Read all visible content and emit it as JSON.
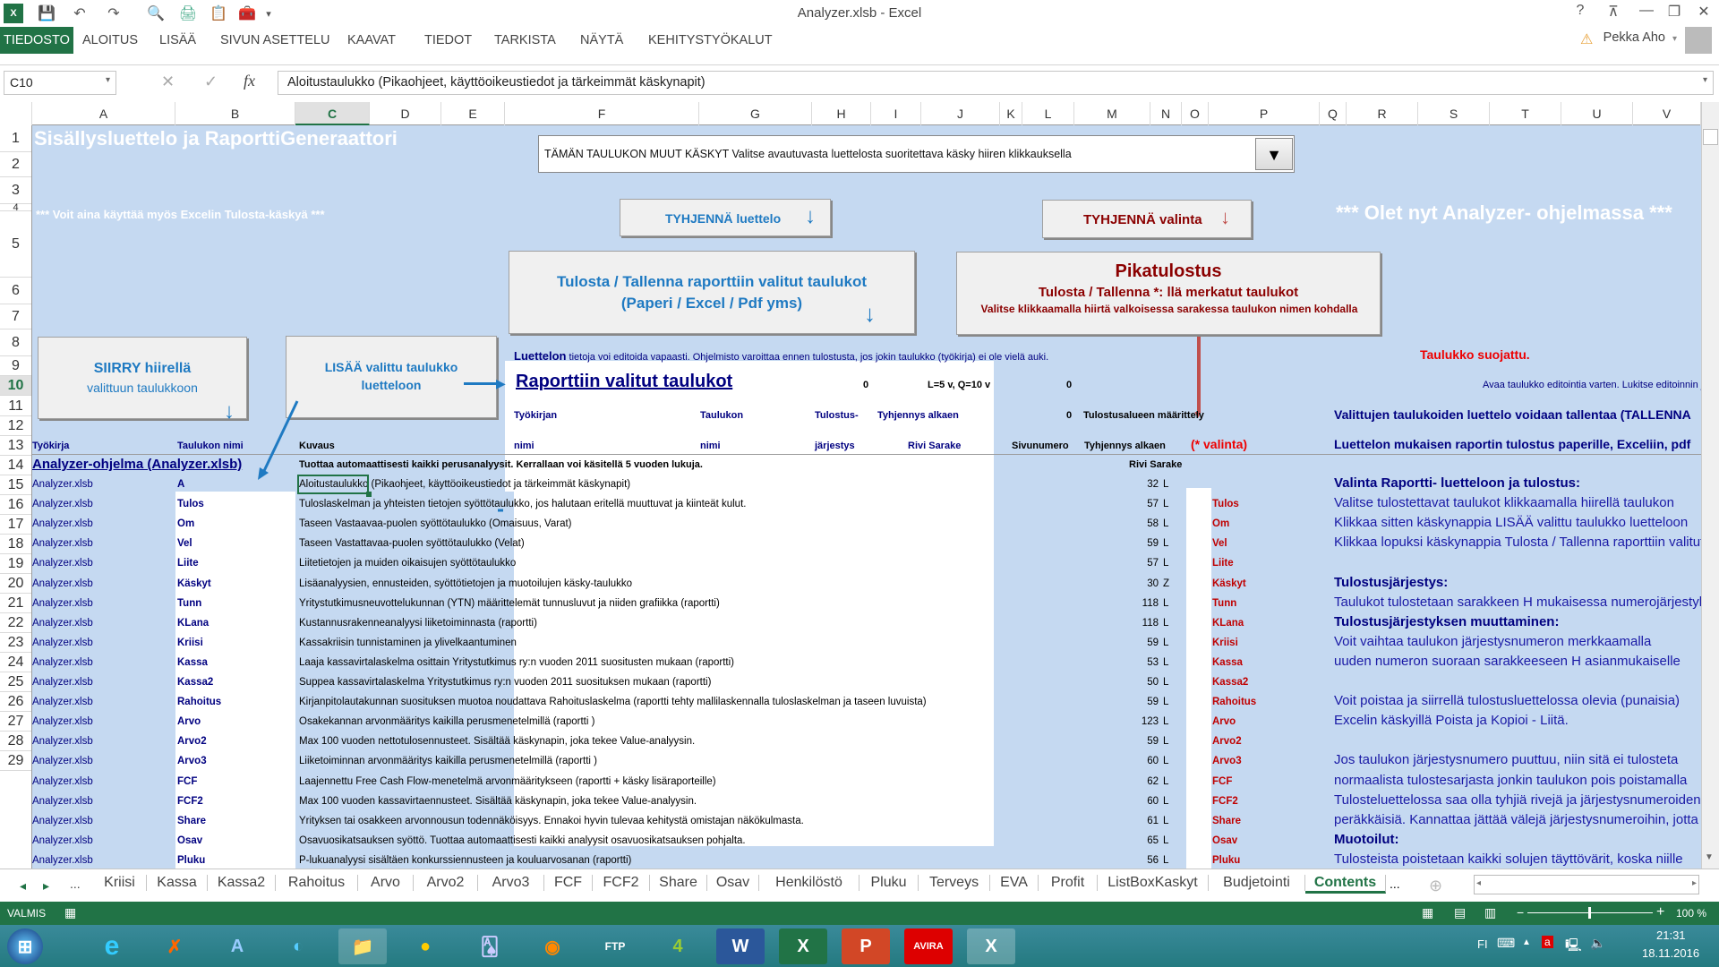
{
  "window": {
    "title": "Analyzer.xlsb - Excel",
    "help": "?",
    "ribbon_display": "⊼",
    "minimize": "—",
    "restore": "❐",
    "close": "✕"
  },
  "qat": {
    "save": "💾",
    "undo": "↶",
    "redo": "↷",
    "print_preview": "🔍",
    "customize": "▾"
  },
  "ribbon": {
    "tabs": [
      "TIEDOSTO",
      "ALOITUS",
      "LISÄÄ",
      "SIVUN ASETTELU",
      "KAAVAT",
      "TIEDOT",
      "TARKISTA",
      "NÄYTÄ",
      "KEHITYSTYÖKALUT"
    ],
    "user": "Pekka Aho",
    "warning_icon": "⚠"
  },
  "formula_bar": {
    "name_box": "C10",
    "cancel": "✕",
    "enter": "✓",
    "fx": "fx",
    "content": "Aloitustaulukko (Pikaohjeet, käyttöoikeustiedot ja tärkeimmät käskynapit)"
  },
  "columns": [
    "A",
    "B",
    "C",
    "D",
    "E",
    "F",
    "G",
    "H",
    "I",
    "J",
    "K",
    "L",
    "M",
    "N",
    "O",
    "P",
    "Q",
    "R",
    "S",
    "T",
    "U",
    "V"
  ],
  "rows": [
    "1",
    "2",
    "3",
    "4",
    "5",
    "6",
    "7",
    "8",
    "9",
    "10",
    "11",
    "12",
    "13",
    "14",
    "15",
    "16",
    "17",
    "18",
    "19",
    "20",
    "21",
    "22",
    "23",
    "24",
    "25",
    "26",
    "27",
    "28",
    "29"
  ],
  "sheet": {
    "title": "Sisällysluettelo ja RaporttiGeneraattori",
    "subtitle": "*** Voit aina käyttää myös Excelin Tulosta-käskyä ***",
    "program_notice": "*** Olet nyt Analyzer- ohjelmassa ***",
    "commands_dropdown": "TÄMÄN TAULUKON MUUT KÄSKYT   Valitse avautuvasta luettelosta suoritettava käsky hiiren klikkauksella",
    "btn_clear_list": "TYHJENNÄ luettelo",
    "btn_clear_selection": "TYHJENNÄ valinta",
    "btn_print_line1": "Tulosta / Tallenna raporttiin valitut taulukot",
    "btn_print_line2": "(Paperi / Excel / Pdf yms)",
    "btn_quick_title": "Pikatulostus",
    "btn_quick_line1": "Tulosta / Tallenna *: llä merkatut taulukot",
    "btn_quick_line2": "Valitse klikkaamalla hiirtä  valkoisessa sarakessa taulukon nimen kohdalla",
    "btn_goto_line1": "SIIRRY hiirellä",
    "btn_goto_line2": "valittuun taulukkoon",
    "btn_add_line1": "LISÄÄ valittu taulukko",
    "btn_add_line2": "luetteloon",
    "luettelon_bold": "Luettelon",
    "luettelon_text": " tietoja voi editoida vapaasti. Ohjelmisto varoittaa ennen tulostusta, jos jokin taulukko (työkirja) ei ole vielä auki.",
    "protected": "Taulukko suojattu.",
    "report_title": "Raporttiin valitut taulukot",
    "r6_h": "0",
    "r6_j": "L=5 v, Q=10 v",
    "r6_l": "0",
    "r6_right": "Avaa taulukko editointia varten. Lukitse editoinnin jälkeen",
    "r7_f": "Työkirjan",
    "r7_g": "Taulukon",
    "r7_h": "Tulostus-",
    "r7_ij": "Tyhjennys alkaen",
    "r7_l": "0",
    "r7_m": "Tulostusalueen määrittely",
    "r7_right": "Valittujen taulukoiden luettelo voidaan tallentaa (TALLENNA",
    "r8_a": "Työkirja",
    "r8_b": "Taulukon nimi",
    "r8_c": "Kuvaus",
    "r8_f": "nimi",
    "r8_g": "nimi",
    "r8_h": "järjestys",
    "r8_ij": "Rivi  Sarake",
    "r8_l": "Sivunumero",
    "r8_m": "Tyhjennys alkaen",
    "r8_o": "(* valinta)",
    "r8_right": "Luettelon mukaisen raportin tulostus paperille, Exceliin, pdf",
    "r9_a": "Analyzer-ohjelma (Analyzer.xlsb)",
    "r9_c": "Tuottaa automaattisesti kaikki perusanalyysit. Kerrallaan voi käsitellä 5 vuoden lukuja.",
    "r9_m": "Rivi  Sarake",
    "help_lines": [
      {
        "text": "Valinta Raportti- luetteloon ja tulostus:",
        "bold": true
      },
      {
        "text": "Valitse tulostettavat taulukot klikkaamalla hiirellä taulukon",
        "bold": false
      },
      {
        "text": "Klikkaa sitten käskynappia LISÄÄ valittu taulukko luetteloon",
        "bold": false
      },
      {
        "text": "Klikkaa lopuksi käskynappia Tulosta / Tallenna raporttiin valitut",
        "bold": false
      },
      {
        "text": "",
        "bold": false
      },
      {
        "text": "Tulostusjärjestys:",
        "bold": true
      },
      {
        "text": "Taulukot tulostetaan sarakkeen H mukaisessa numerojärjestyksessä",
        "bold": false
      },
      {
        "text": "Tulostusjärjestyksen muuttaminen:",
        "bold": true
      },
      {
        "text": "Voit vaihtaa taulukon järjestysnumeron merkkaamalla",
        "bold": false
      },
      {
        "text": "uuden numeron suoraan sarakkeeseen H asianmukaiselle",
        "bold": false
      },
      {
        "text": "",
        "bold": false
      },
      {
        "text": "Voit poistaa ja siirrellä tulostusluettelossa olevia (punaisia)",
        "bold": false
      },
      {
        "text": "Excelin käskyillä Poista ja  Kopioi - Liitä.",
        "bold": false
      },
      {
        "text": "",
        "bold": false
      },
      {
        "text": "Jos taulukon järjestysnumero puuttuu, niin sitä ei tulosteta",
        "bold": false
      },
      {
        "text": "normaalista tulostesarjasta jonkin taulukon pois poistamalla",
        "bold": false
      },
      {
        "text": "Tulosteluettelossa saa olla tyhjiä rivejä ja järjestysnumeroiden",
        "bold": false
      },
      {
        "text": "peräkkäisiä. Kannattaa jättää välejä järjestysnumeroihin, jotta",
        "bold": false
      },
      {
        "text": "Muotoilut:",
        "bold": true
      },
      {
        "text": "Tulosteista poistetaan kaikki solujen täyttövärit, koska niille",
        "bold": false
      }
    ],
    "table": [
      {
        "wb": "Analyzer.xlsb",
        "name": "A",
        "desc": "Aloitustaulukko (Pikaohjeet, käyttöoikeustiedot ja tärkeimmät käskynapit)",
        "row": "32",
        "col": "L",
        "sel": ""
      },
      {
        "wb": "Analyzer.xlsb",
        "name": "Tulos",
        "desc": "Tuloslaskelman ja yhteisten tietojen syöttötaulukko, jos halutaan eritellä muuttuvat ja kiinteät kulut.",
        "row": "57",
        "col": "L",
        "sel": "Tulos"
      },
      {
        "wb": "Analyzer.xlsb",
        "name": "Om",
        "desc": "Taseen Vastaavaa-puolen syöttötaulukko (Omaisuus, Varat)",
        "row": "58",
        "col": "L",
        "sel": "Om"
      },
      {
        "wb": "Analyzer.xlsb",
        "name": "Vel",
        "desc": "Taseen Vastattavaa-puolen syöttötaulukko (Velat)",
        "row": "59",
        "col": "L",
        "sel": "Vel"
      },
      {
        "wb": "Analyzer.xlsb",
        "name": "Liite",
        "desc": "Liitetietojen ja muiden oikaisujen syöttötaulukko",
        "row": "57",
        "col": "L",
        "sel": "Liite"
      },
      {
        "wb": "Analyzer.xlsb",
        "name": "Käskyt",
        "desc": "Lisäanalyysien, ennusteiden, syöttötietojen ja muotoilujen käsky-taulukko",
        "row": "30",
        "col": "Z",
        "sel": "Käskyt"
      },
      {
        "wb": "Analyzer.xlsb",
        "name": "Tunn",
        "desc": "Yritystutkimusneuvottelukunnan (YTN) määrittelemät tunnusluvut ja niiden grafiikka (raportti)",
        "row": "118",
        "col": "L",
        "sel": "Tunn"
      },
      {
        "wb": "Analyzer.xlsb",
        "name": "KLana",
        "desc": "Kustannusrakenneanalyysi liiketoiminnasta (raportti)",
        "row": "118",
        "col": "L",
        "sel": "KLana"
      },
      {
        "wb": "Analyzer.xlsb",
        "name": "Kriisi",
        "desc": "Kassakriisin tunnistaminen ja ylivelkaantuminen",
        "row": "59",
        "col": "L",
        "sel": "Kriisi"
      },
      {
        "wb": "Analyzer.xlsb",
        "name": "Kassa",
        "desc": "Laaja kassavirtalaskelma osittain Yritystutkimus ry:n vuoden 2011 suositusten mukaan (raportti)",
        "row": "53",
        "col": "L",
        "sel": "Kassa"
      },
      {
        "wb": "Analyzer.xlsb",
        "name": "Kassa2",
        "desc": "Suppea kassavirtalaskelma Yritystutkimus ry:n vuoden 2011 suosituksen mukaan (raportti)",
        "row": "50",
        "col": "L",
        "sel": "Kassa2"
      },
      {
        "wb": "Analyzer.xlsb",
        "name": "Rahoitus",
        "desc": "Kirjanpitolautakunnan suosituksen muotoa noudattava Rahoituslaskelma (raportti tehty mallilaskennalla tuloslaskelman ja taseen luvuista)",
        "row": "59",
        "col": "L",
        "sel": "Rahoitus"
      },
      {
        "wb": "Analyzer.xlsb",
        "name": "Arvo",
        "desc": "Osakekannan arvonmääritys kaikilla perusmenetelmillä (raportti )",
        "row": "123",
        "col": "L",
        "sel": "Arvo"
      },
      {
        "wb": "Analyzer.xlsb",
        "name": "Arvo2",
        "desc": "Max 100 vuoden nettotulosennusteet. Sisältää käskynapin, joka tekee Value-analyysin.",
        "row": "59",
        "col": "L",
        "sel": "Arvo2"
      },
      {
        "wb": "Analyzer.xlsb",
        "name": "Arvo3",
        "desc": "Liiketoiminnan arvonmääritys kaikilla perusmenetelmillä (raportti )",
        "row": "60",
        "col": "L",
        "sel": "Arvo3"
      },
      {
        "wb": "Analyzer.xlsb",
        "name": "FCF",
        "desc": "Laajennettu Free Cash Flow-menetelmä arvonmääritykseen (raportti + käsky lisäraporteille)",
        "row": "62",
        "col": "L",
        "sel": "FCF"
      },
      {
        "wb": "Analyzer.xlsb",
        "name": "FCF2",
        "desc": "Max 100 vuoden kassavirtaennusteet. Sisältää käskynapin, joka tekee Value-analyysin.",
        "row": "60",
        "col": "L",
        "sel": "FCF2"
      },
      {
        "wb": "Analyzer.xlsb",
        "name": "Share",
        "desc": "Yrityksen tai osakkeen arvonnousun todennäköisyys. Ennakoi hyvin tulevaa kehitystä omistajan näkökulmasta.",
        "row": "61",
        "col": "L",
        "sel": "Share"
      },
      {
        "wb": "Analyzer.xlsb",
        "name": "Osav",
        "desc": "Osavuosikatsauksen syöttö. Tuottaa automaattisesti kaikki analyysit osavuosikatsauksen pohjalta.",
        "row": "65",
        "col": "L",
        "sel": "Osav"
      },
      {
        "wb": "Analyzer.xlsb",
        "name": "Pluku",
        "desc": "P-lukuanalyysi sisältäen konkurssiennusteen ja kouluarvosanan (raportti)",
        "row": "56",
        "col": "L",
        "sel": "Pluku"
      }
    ]
  },
  "sheet_tabs": {
    "prev": "◂",
    "next": "▸",
    "more_left": "...",
    "tabs": [
      "Kriisi",
      "Kassa",
      "Kassa2",
      "Rahoitus",
      "Arvo",
      "Arvo2",
      "Arvo3",
      "FCF",
      "FCF2",
      "Share",
      "Osav",
      "Henkilöstö",
      "Pluku",
      "Terveys",
      "EVA",
      "Profit",
      "ListBoxKaskyt",
      "Budjetointi",
      "Contents"
    ],
    "active": "Contents",
    "more_right": "...",
    "add": "⊕"
  },
  "status": {
    "ready": "VALMIS",
    "zoom": "100 %",
    "zoom_out": "−",
    "zoom_in": "+"
  },
  "taskbar": {
    "lang": "FI",
    "time": "21:31",
    "date": "18.11.2016"
  }
}
